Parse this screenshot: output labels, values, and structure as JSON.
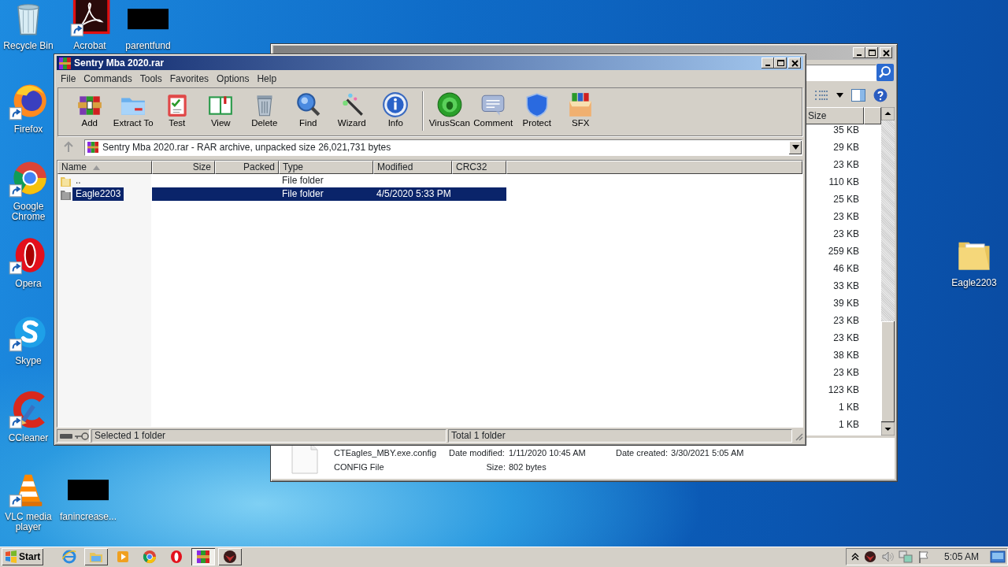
{
  "desktop_icons": [
    {
      "label": "Recycle Bin",
      "kind": "recycle",
      "shortcut": false
    },
    {
      "label": "Acrobat",
      "kind": "acrobat",
      "shortcut": true
    },
    {
      "label": "parentfund",
      "kind": "hidden",
      "shortcut": false
    },
    {
      "label": "Firefox",
      "kind": "firefox",
      "shortcut": true
    },
    {
      "label": "Google Chrome",
      "kind": "chrome",
      "shortcut": true
    },
    {
      "label": "Opera",
      "kind": "opera",
      "shortcut": true
    },
    {
      "label": "Skype",
      "kind": "skype",
      "shortcut": true
    },
    {
      "label": "CCleaner",
      "kind": "ccleaner",
      "shortcut": true
    },
    {
      "label": "VLC media player",
      "kind": "vlc",
      "shortcut": true
    },
    {
      "label": "fanincrease...",
      "kind": "hidden",
      "shortcut": false
    },
    {
      "label": "Eagle2203",
      "kind": "folder",
      "shortcut": false
    }
  ],
  "explorer": {
    "size_header": "Size",
    "sizes": [
      "35 KB",
      "29 KB",
      "23 KB",
      "110 KB",
      "25 KB",
      "23 KB",
      "23 KB",
      "259 KB",
      "46 KB",
      "33 KB",
      "39 KB",
      "23 KB",
      "23 KB",
      "38 KB",
      "23 KB",
      "123 KB",
      "1 KB",
      "1 KB"
    ],
    "details": {
      "file_name": "CTEagles_MBY.exe.config",
      "modified_label": "Date modified:",
      "modified": "1/11/2020 10:45 AM",
      "created_label": "Date created:",
      "created": "3/30/2021 5:05 AM",
      "file_type": "CONFIG File",
      "size_label": "Size:",
      "size": "802 bytes"
    }
  },
  "winrar": {
    "title": "Sentry Mba 2020.rar",
    "menu": [
      "File",
      "Commands",
      "Tools",
      "Favorites",
      "Options",
      "Help"
    ],
    "toolbar": [
      {
        "label": "Add",
        "kind": "add",
        "separator_before": false
      },
      {
        "label": "Extract To",
        "kind": "extract",
        "separator_before": false
      },
      {
        "label": "Test",
        "kind": "test",
        "separator_before": false
      },
      {
        "label": "View",
        "kind": "view",
        "separator_before": false
      },
      {
        "label": "Delete",
        "kind": "delete",
        "separator_before": false
      },
      {
        "label": "Find",
        "kind": "find",
        "separator_before": false
      },
      {
        "label": "Wizard",
        "kind": "wizard",
        "separator_before": false
      },
      {
        "label": "Info",
        "kind": "info",
        "separator_before": false
      },
      {
        "label": "VirusScan",
        "kind": "virus",
        "separator_before": true
      },
      {
        "label": "Comment",
        "kind": "comment",
        "separator_before": false
      },
      {
        "label": "Protect",
        "kind": "protect",
        "separator_before": false
      },
      {
        "label": "SFX",
        "kind": "sfx",
        "separator_before": false
      }
    ],
    "address": "Sentry Mba 2020.rar - RAR archive, unpacked size 26,021,731 bytes",
    "columns": [
      "Name",
      "Size",
      "Packed",
      "Type",
      "Modified",
      "CRC32"
    ],
    "rows": [
      {
        "name": "..",
        "type": "File folder",
        "selected": false,
        "kind": "up"
      },
      {
        "name": "Eagle2203",
        "type": "File folder",
        "modified": "4/5/2020 5:33 PM",
        "selected": true,
        "kind": "folder"
      }
    ],
    "status_left": "Selected 1 folder",
    "status_right": "Total 1 folder"
  },
  "taskbar": {
    "start": "Start",
    "apps": [
      {
        "kind": "ie",
        "open": false,
        "selected": false
      },
      {
        "kind": "explorer",
        "open": true,
        "selected": false
      },
      {
        "kind": "media",
        "open": false,
        "selected": false
      },
      {
        "kind": "chrome",
        "open": false,
        "selected": false
      },
      {
        "kind": "opera",
        "open": false,
        "selected": false
      },
      {
        "kind": "winrar",
        "open": true,
        "selected": true
      },
      {
        "kind": "eagle",
        "open": true,
        "selected": false
      }
    ],
    "clock": "5:05 AM"
  }
}
